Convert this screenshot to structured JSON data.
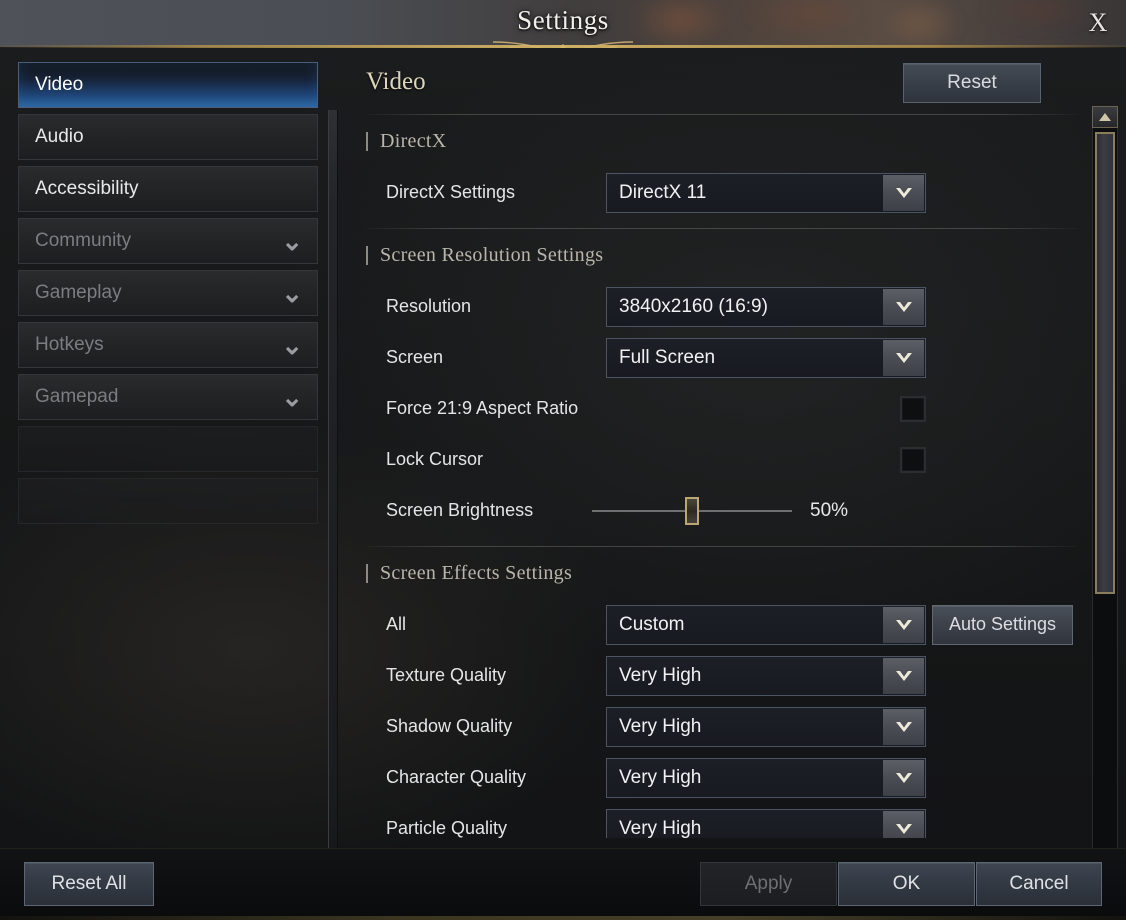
{
  "window": {
    "title": "Settings",
    "close_label": "X"
  },
  "sidebar": {
    "items": [
      {
        "label": "Video",
        "selected": true,
        "dim": false,
        "expandable": false
      },
      {
        "label": "Audio",
        "selected": false,
        "dim": false,
        "expandable": false
      },
      {
        "label": "Accessibility",
        "selected": false,
        "dim": false,
        "expandable": false
      },
      {
        "label": "Community",
        "selected": false,
        "dim": true,
        "expandable": true
      },
      {
        "label": "Gameplay",
        "selected": false,
        "dim": true,
        "expandable": true
      },
      {
        "label": "Hotkeys",
        "selected": false,
        "dim": true,
        "expandable": true
      },
      {
        "label": "Gamepad",
        "selected": false,
        "dim": true,
        "expandable": true
      }
    ]
  },
  "main": {
    "title": "Video",
    "reset_label": "Reset",
    "sections": [
      {
        "heading": "DirectX",
        "rows": [
          {
            "type": "dropdown",
            "label": "DirectX Settings",
            "value": "DirectX 11"
          }
        ]
      },
      {
        "heading": "Screen Resolution Settings",
        "rows": [
          {
            "type": "dropdown",
            "label": "Resolution",
            "value": "3840x2160 (16:9)"
          },
          {
            "type": "dropdown",
            "label": "Screen",
            "value": "Full Screen"
          },
          {
            "type": "checkbox",
            "label": "Force 21:9 Aspect Ratio",
            "checked": false
          },
          {
            "type": "checkbox",
            "label": "Lock Cursor",
            "checked": false
          },
          {
            "type": "slider",
            "label": "Screen Brightness",
            "value": "50%",
            "percent": 50
          }
        ]
      },
      {
        "heading": "Screen Effects Settings",
        "rows": [
          {
            "type": "dropdown",
            "label": "All",
            "value": "Custom",
            "extra_button": "Auto Settings"
          },
          {
            "type": "dropdown",
            "label": "Texture Quality",
            "value": "Very High"
          },
          {
            "type": "dropdown",
            "label": "Shadow Quality",
            "value": "Very High"
          },
          {
            "type": "dropdown",
            "label": "Character Quality",
            "value": "Very High"
          },
          {
            "type": "dropdown",
            "label": "Particle Quality",
            "value": "Very High"
          }
        ]
      }
    ]
  },
  "footer": {
    "reset_all": "Reset All",
    "apply": "Apply",
    "ok": "OK",
    "cancel": "Cancel"
  },
  "colors": {
    "accent_gold": "#d6b668",
    "selected_blue": "#2f6ba8",
    "heading_cream": "#ddd6bd"
  }
}
